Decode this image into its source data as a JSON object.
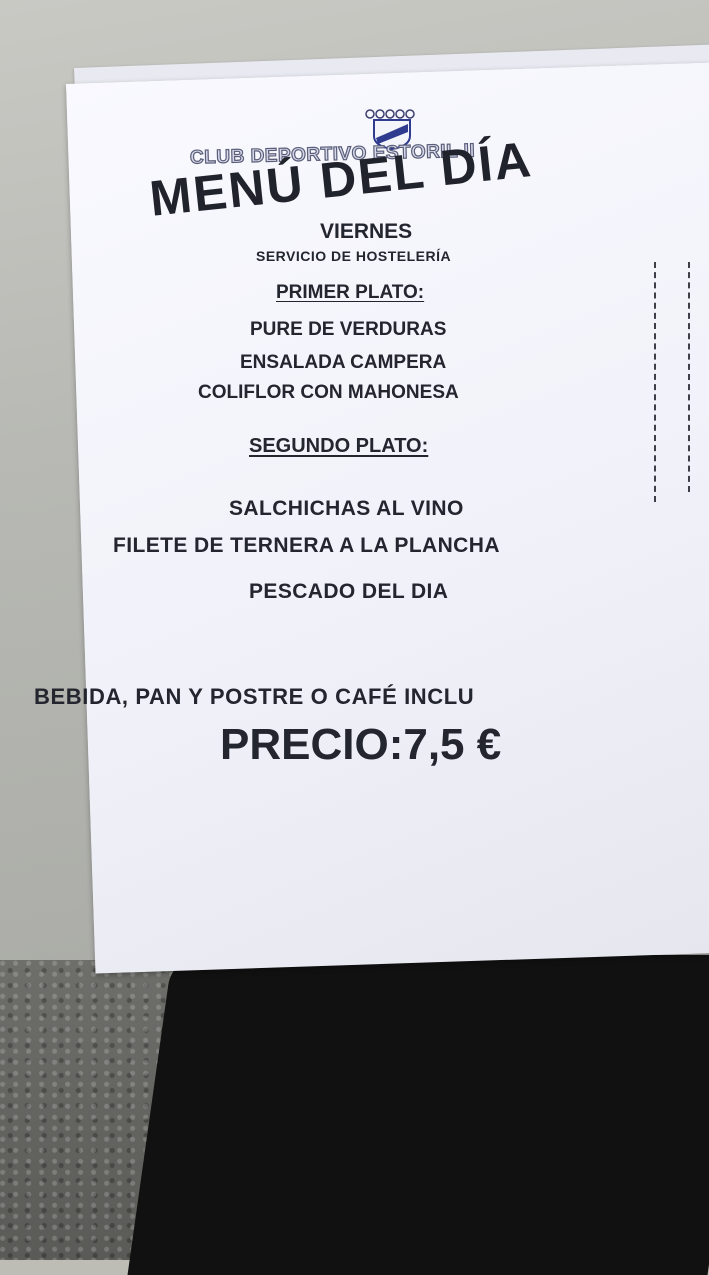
{
  "menu": {
    "club": "CLUB DEPORTIVO ESTORIL II",
    "title": "MENÚ DEL DÍA",
    "day": "VIERNES",
    "service": "SERVICIO DE HOSTELERÍA",
    "first_course_heading": "PRIMER PLATO:",
    "first_course": [
      "PURE DE VERDURAS",
      "ENSALADA CAMPERA",
      "COLIFLOR CON MAHONESA"
    ],
    "second_course_heading": "SEGUNDO PLATO:",
    "second_course": [
      "SALCHICHAS AL VINO",
      "FILETE DE TERNERA A LA PLANCHA",
      "PESCADO DEL DIA"
    ],
    "included": "BEBIDA, PAN Y POSTRE O CAFÉ  INCLU",
    "price": "PRECIO:7,5 €"
  },
  "colors": {
    "paper": "#f4f4fb",
    "ink": "#23262e",
    "logo_blue": "#2f3b8f"
  }
}
